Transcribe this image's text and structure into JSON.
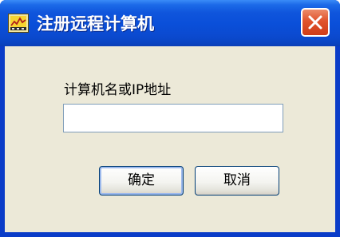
{
  "window": {
    "title": "注册远程计算机",
    "icon": "labview-app-icon",
    "close_icon": "close-x-icon"
  },
  "form": {
    "label": "计算机名或IP地址",
    "input_value": "",
    "input_placeholder": ""
  },
  "buttons": {
    "ok_label": "确定",
    "cancel_label": "取消"
  },
  "colors": {
    "titlebar": "#0a4fd9",
    "client_background": "#ece9d8",
    "close_button": "#e0532c"
  }
}
